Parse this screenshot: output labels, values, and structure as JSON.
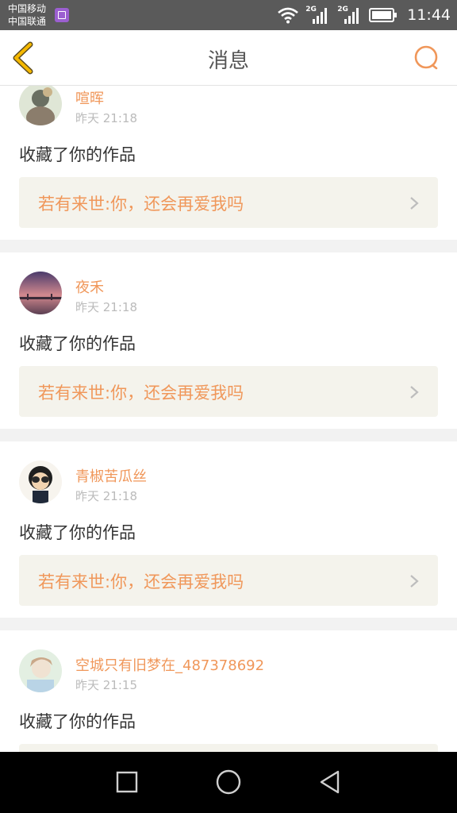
{
  "status_bar": {
    "carrier_1": "中国移动",
    "carrier_2": "中国联通",
    "net_1": "2G",
    "net_2": "2G",
    "time": "11:44",
    "icons": [
      "app-notification-icon",
      "wifi-icon",
      "signal-icon",
      "signal-icon",
      "battery-icon"
    ]
  },
  "header": {
    "title": "消息",
    "back_icon": "back-arrow-icon",
    "search_icon": "search-icon"
  },
  "theme": {
    "accent": "#f0975a",
    "back_icon_color": "#f5b800",
    "card_link_bg": "#f4f3ec"
  },
  "notifications": [
    {
      "username": "喧晖",
      "time": "昨天 21:18",
      "action": "收藏了你的作品",
      "work_title": "若有来世:你，还会再爱我吗"
    },
    {
      "username": "夜禾",
      "time": "昨天 21:18",
      "action": "收藏了你的作品",
      "work_title": "若有来世:你，还会再爱我吗"
    },
    {
      "username": "青椒苦瓜丝",
      "time": "昨天 21:18",
      "action": "收藏了你的作品",
      "work_title": "若有来世:你，还会再爱我吗"
    },
    {
      "username": "空城只有旧梦在_487378692",
      "time": "昨天 21:15",
      "action": "收藏了你的作品",
      "work_title": ""
    }
  ],
  "nav_bar": {
    "icons": [
      "recent-apps-icon",
      "home-icon",
      "back-icon"
    ]
  }
}
